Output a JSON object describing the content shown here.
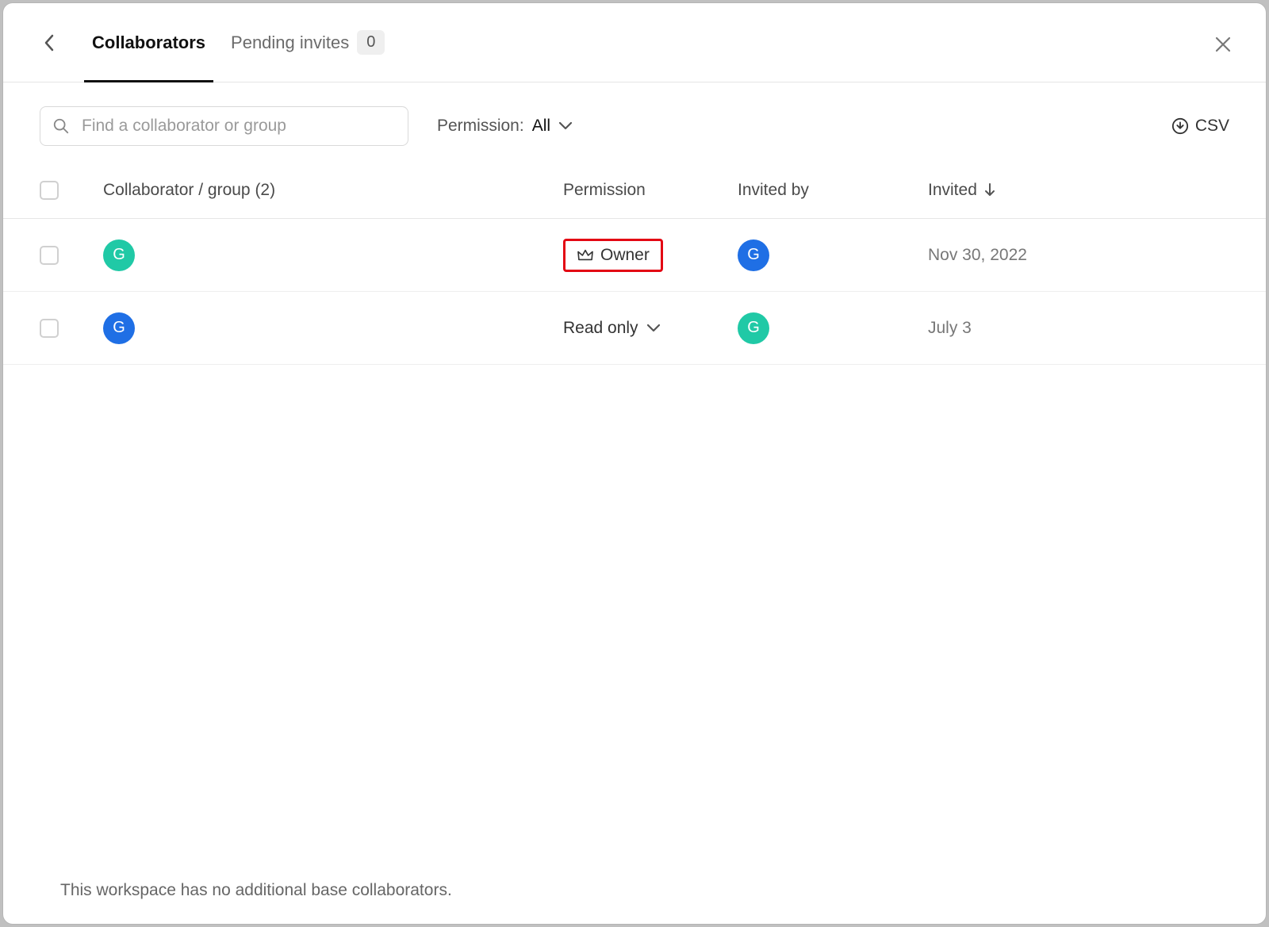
{
  "tabs": {
    "collaborators": "Collaborators",
    "pending": "Pending invites",
    "pending_count": "0"
  },
  "search": {
    "placeholder": "Find a collaborator or group"
  },
  "filter": {
    "label": "Permission: ",
    "value": "All"
  },
  "csv_label": "CSV",
  "columns": {
    "collab": "Collaborator / group (2)",
    "perm": "Permission",
    "invited_by": "Invited by",
    "invited": "Invited"
  },
  "rows": [
    {
      "avatar_initial": "G",
      "avatar_color": "teal",
      "permission": "Owner",
      "permission_type": "owner",
      "invited_by_initial": "G",
      "invited_by_color": "blue",
      "invited_date": "Nov 30, 2022"
    },
    {
      "avatar_initial": "G",
      "avatar_color": "blue",
      "permission": "Read only",
      "permission_type": "select",
      "invited_by_initial": "G",
      "invited_by_color": "teal",
      "invited_date": "July 3"
    }
  ],
  "footer_text": "This workspace has no additional base collaborators."
}
